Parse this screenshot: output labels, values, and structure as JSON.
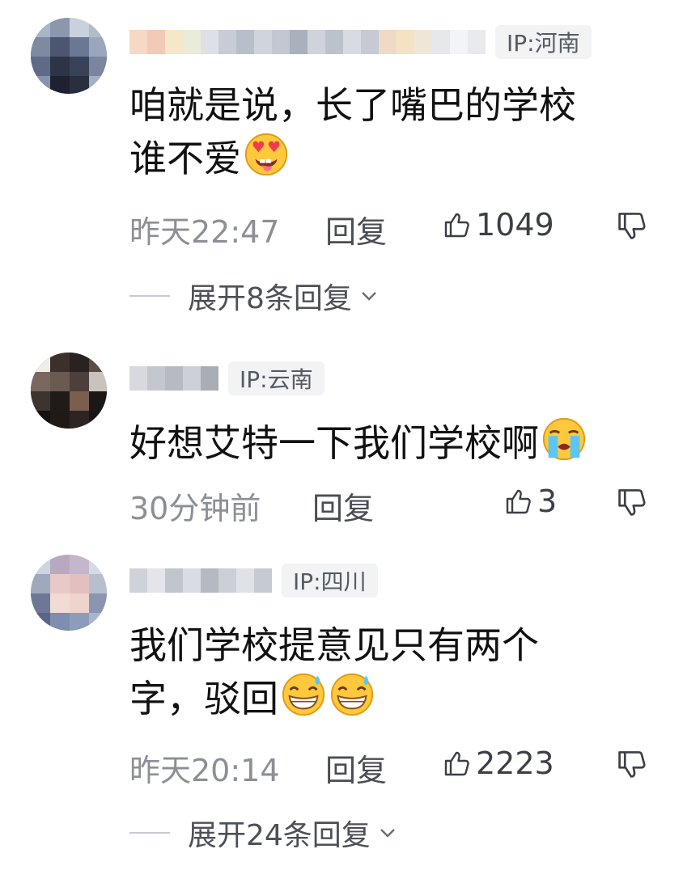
{
  "comments": [
    {
      "ip": "IP:河南",
      "text": "咱就是说，长了嘴巴的学校\n谁不爱",
      "emojis": [
        "tongue-heart-eyes"
      ],
      "time": "昨天22:47",
      "reply_label": "回复",
      "likes": "1049",
      "expand_label": "展开8条回复"
    },
    {
      "ip": "IP:云南",
      "text": "好想艾特一下我们学校啊",
      "emojis": [
        "loudly-crying"
      ],
      "time": "30分钟前",
      "reply_label": "回复",
      "likes": "3"
    },
    {
      "ip": "IP:四川",
      "text": "我们学校提意见只有两个\n字，驳回",
      "emojis": [
        "grinning-sweat",
        "grinning-sweat"
      ],
      "time": "昨天20:14",
      "reply_label": "回复",
      "likes": "2223",
      "expand_label": "展开24条回复"
    }
  ],
  "colors": {
    "meta": "#8c8f96",
    "badge_bg": "#f2f3f5",
    "text": "#111111"
  }
}
